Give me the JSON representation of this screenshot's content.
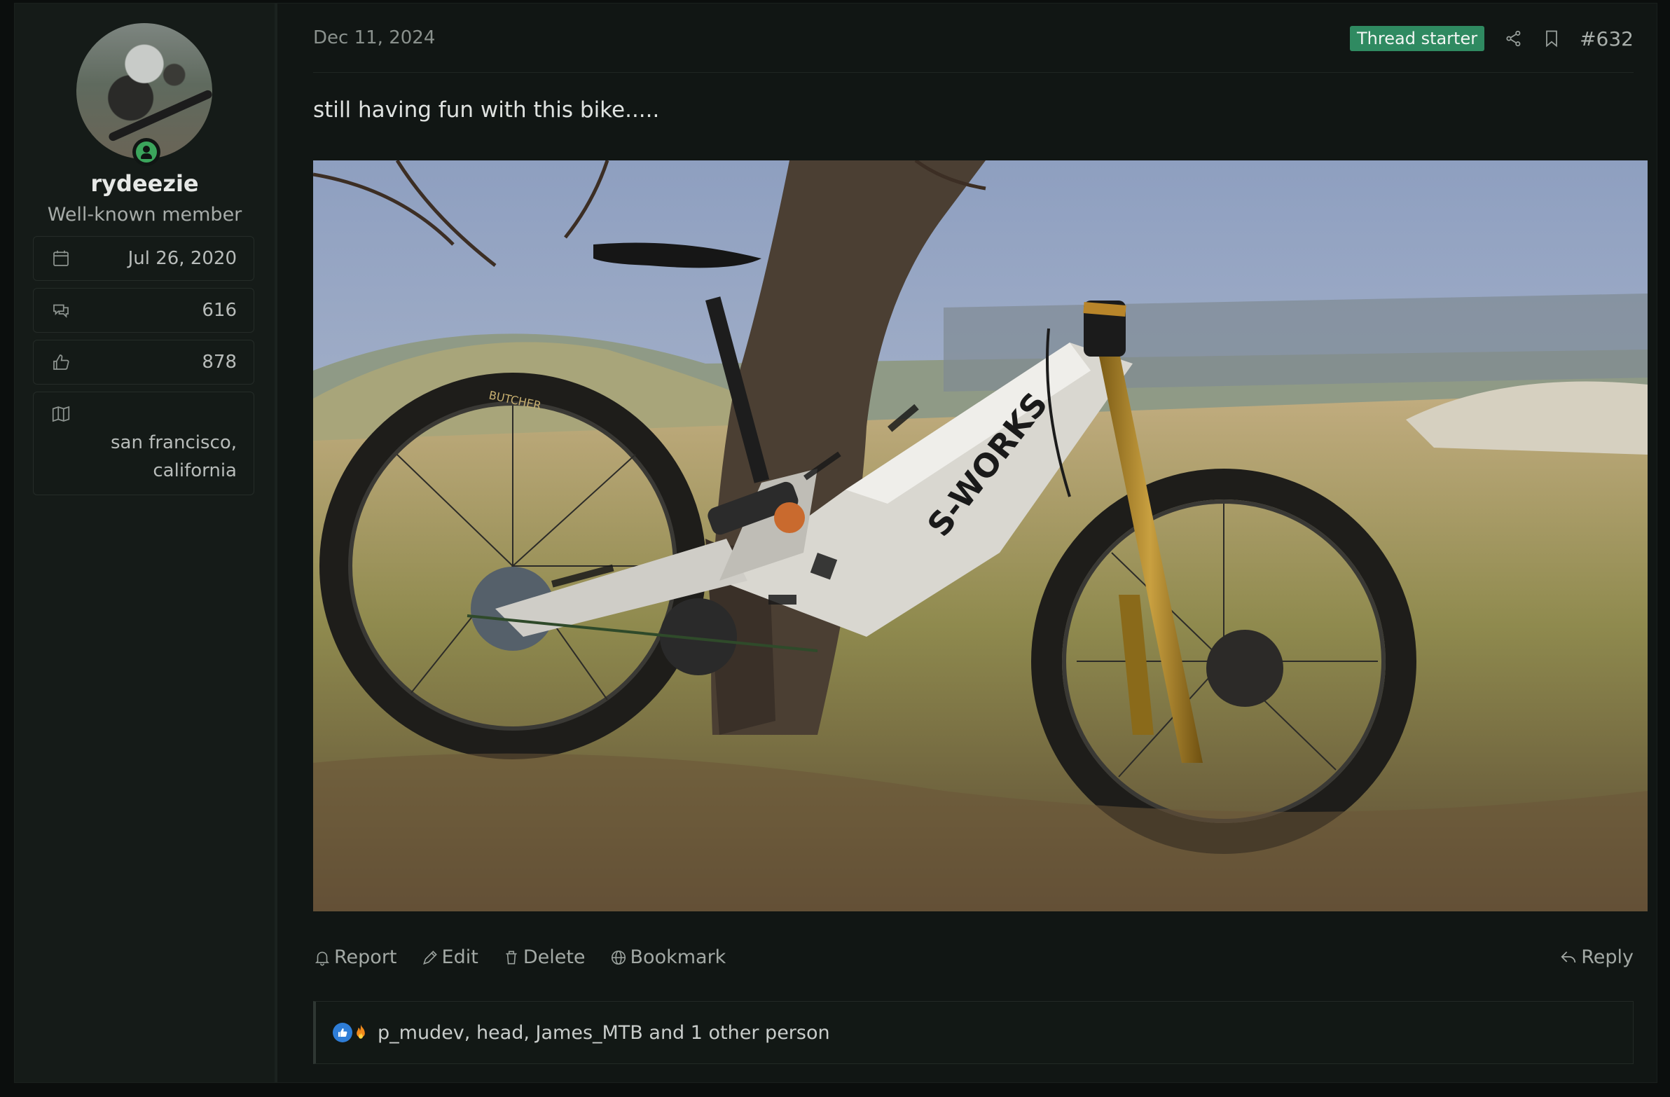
{
  "user": {
    "username": "rydeezie",
    "title": "Well-known member",
    "joined": "Jul 26, 2020",
    "messages": "616",
    "reactions": "878",
    "location": "san francisco, california",
    "online": true
  },
  "post": {
    "date": "Dec 11, 2024",
    "badge": "Thread starter",
    "number": "#632",
    "message": "still having fun with this bike.....",
    "image_alt": "S-Works mountain bike leaning against a tree"
  },
  "actions": {
    "report": "Report",
    "edit": "Edit",
    "delete": "Delete",
    "bookmark": "Bookmark",
    "reply": "Reply"
  },
  "reactions_bar": {
    "text": "p_mudev, head, James_MTB and 1 other person",
    "icons": [
      "like-icon",
      "fire-icon"
    ]
  },
  "photo_text": {
    "frame_brand": "S-WORKS",
    "tire_brand": "BUTCHER"
  },
  "colors": {
    "background": "#0b0e0d",
    "panel": "#111614",
    "sidebar": "#151b18",
    "badge": "#2f8a61",
    "online": "#3ba55c",
    "like": "#2e7dd7"
  }
}
